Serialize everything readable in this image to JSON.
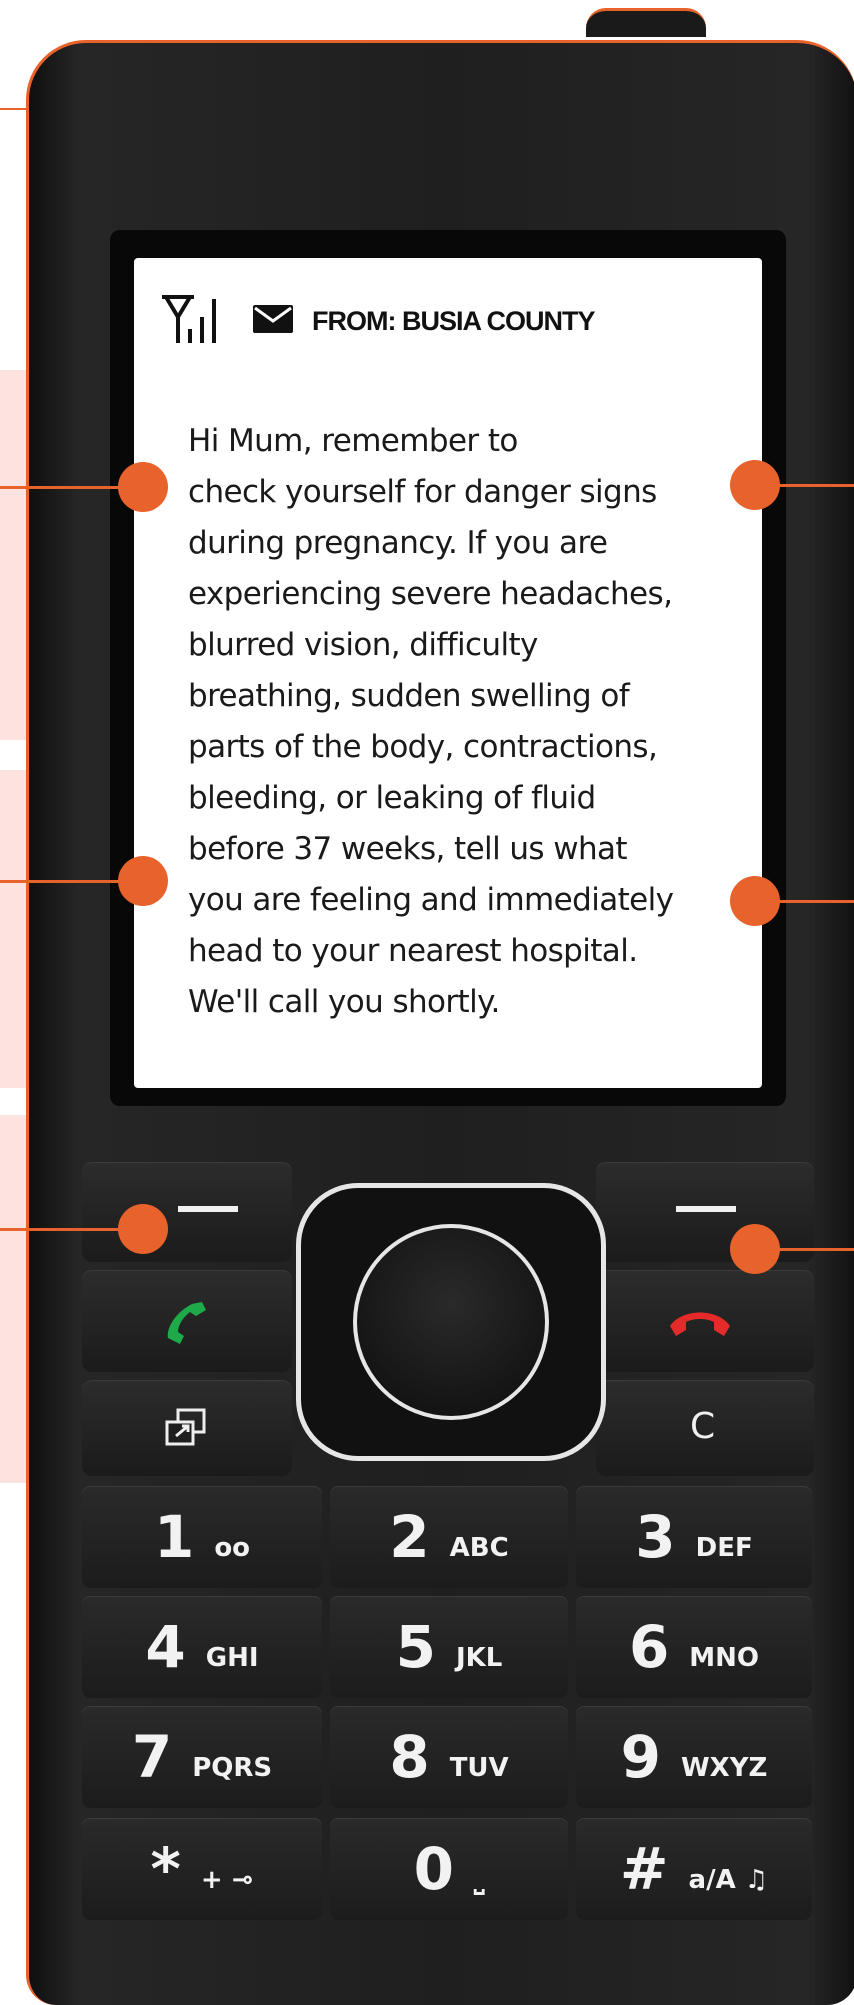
{
  "status": {
    "signal_icon": "signal-antenna-icon",
    "envelope_icon": "envelope-icon",
    "from_label": "FROM: BUSIA COUNTY"
  },
  "message": {
    "lines": [
      "Hi Mum, remember to",
      "check yourself for danger signs",
      "during pregnancy. If you are",
      "experiencing severe headaches,",
      "blurred vision, difficulty",
      "breathing, sudden swelling of",
      "parts of the body, contractions,",
      "bleeding, or leaking of fluid",
      "before 37 weeks, tell us what",
      "you are feeling and immediately",
      "head to your nearest hospital.",
      "We'll call you shortly."
    ]
  },
  "keys": {
    "clear_label": "C",
    "numeric": [
      {
        "num": "1",
        "sub": "oo"
      },
      {
        "num": "2",
        "sub": "ABC"
      },
      {
        "num": "3",
        "sub": "DEF"
      },
      {
        "num": "4",
        "sub": "GHI"
      },
      {
        "num": "5",
        "sub": "JKL"
      },
      {
        "num": "6",
        "sub": "MNO"
      },
      {
        "num": "7",
        "sub": "PQRS"
      },
      {
        "num": "8",
        "sub": "TUV"
      },
      {
        "num": "9",
        "sub": "WXYZ"
      },
      {
        "num": "*",
        "sub": "+ ⊸"
      },
      {
        "num": "0",
        "sub": "⎵"
      },
      {
        "num": "#",
        "sub": "a/A ♫"
      }
    ]
  },
  "colors": {
    "accent": "#e8632b",
    "call_green": "#1faa4a",
    "end_red": "#e52a2a",
    "panel_pink": "#fde3e0"
  }
}
